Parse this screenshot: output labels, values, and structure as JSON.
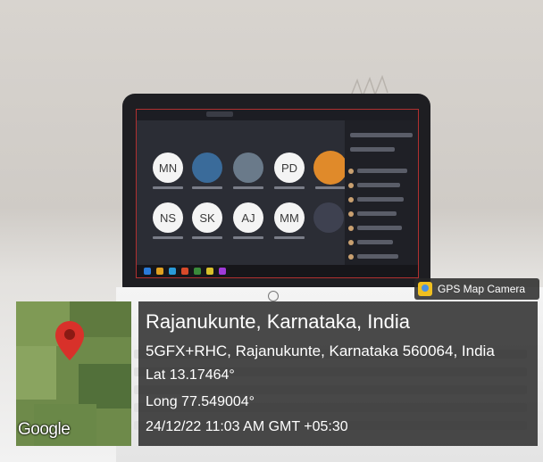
{
  "photo": {
    "participants": [
      "MN",
      "PD",
      "NS",
      "SK",
      "AJ",
      "MM"
    ]
  },
  "overlay": {
    "badge_label": "GPS Map Camera",
    "badge_icon": "gps-map-camera-icon",
    "map_brand": "Google",
    "place_title": "Rajanukunte, Karnataka, India",
    "address": "5GFX+RHC, Rajanukunte, Karnataka 560064, India",
    "latitude": "Lat 13.17464°",
    "longitude": "Long 77.549004°",
    "timestamp": "24/12/22 11:03 AM GMT +05:30",
    "pin_color": "#d8312a"
  }
}
